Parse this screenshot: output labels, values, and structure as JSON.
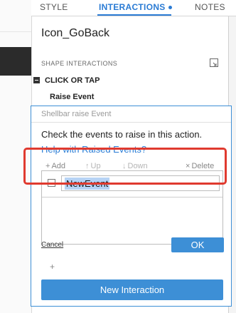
{
  "tabs": {
    "style": "STYLE",
    "interactions": "INTERACTIONS",
    "notes": "NOTES"
  },
  "shape_name": "Icon_GoBack",
  "section_label": "SHAPE INTERACTIONS",
  "event": {
    "title": "CLICK OR TAP",
    "action": "Raise Event"
  },
  "dialog": {
    "title": "Shellbar raise Event",
    "instruction": "Check the events to raise in this action.",
    "help_link": "Help with Raised Events?",
    "toolbar": {
      "add": "Add",
      "up": "Up",
      "down": "Down",
      "delete": "Delete"
    },
    "events": [
      {
        "name": "NewEvent",
        "checked": false
      }
    ],
    "cancel": "Cancel",
    "ok": "OK"
  },
  "new_interaction_button": "New Interaction",
  "colors": {
    "accent": "#3d8fd6",
    "highlight": "#e03a2f"
  }
}
